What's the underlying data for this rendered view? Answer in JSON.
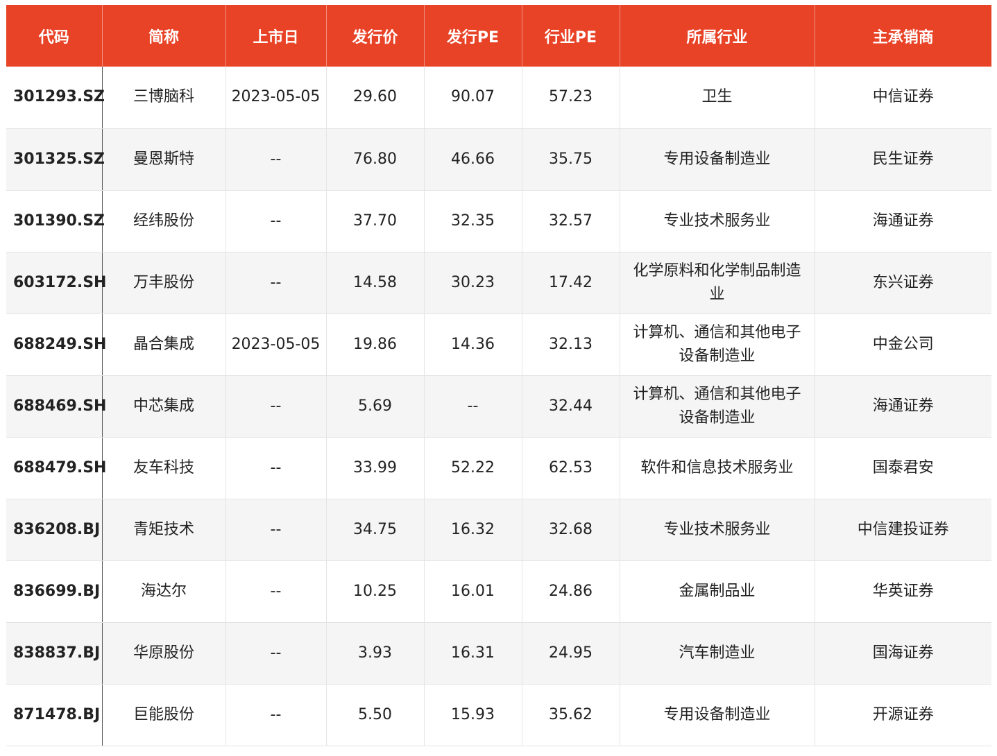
{
  "table": {
    "headers": [
      "代码",
      "简称",
      "上市日",
      "发行价",
      "发行PE",
      "行业PE",
      "所属行业",
      "主承销商"
    ],
    "rows": [
      [
        "301293.SZ",
        "三博脑科",
        "2023-05-05",
        "29.60",
        "90.07",
        "57.23",
        "卫生",
        "中信证券"
      ],
      [
        "301325.SZ",
        "曼恩斯特",
        "--",
        "76.80",
        "46.66",
        "35.75",
        "专用设备制造业",
        "民生证券"
      ],
      [
        "301390.SZ",
        "经纬股份",
        "--",
        "37.70",
        "32.35",
        "32.57",
        "专业技术服务业",
        "海通证券"
      ],
      [
        "603172.SH",
        "万丰股份",
        "--",
        "14.58",
        "30.23",
        "17.42",
        "化学原料和化学制品制造业",
        "东兴证券"
      ],
      [
        "688249.SH",
        "晶合集成",
        "2023-05-05",
        "19.86",
        "14.36",
        "32.13",
        "计算机、通信和其他电子设备制造业",
        "中金公司"
      ],
      [
        "688469.SH",
        "中芯集成",
        "--",
        "5.69",
        "--",
        "32.44",
        "计算机、通信和其他电子设备制造业",
        "海通证券"
      ],
      [
        "688479.SH",
        "友车科技",
        "--",
        "33.99",
        "52.22",
        "62.53",
        "软件和信息技术服务业",
        "国泰君安"
      ],
      [
        "836208.BJ",
        "青矩技术",
        "--",
        "34.75",
        "16.32",
        "32.68",
        "专业技术服务业",
        "中信建投证券"
      ],
      [
        "836699.BJ",
        "海达尔",
        "--",
        "10.25",
        "16.01",
        "24.86",
        "金属制品业",
        "华英证券"
      ],
      [
        "838837.BJ",
        "华原股份",
        "--",
        "3.93",
        "16.31",
        "24.95",
        "汽车制造业",
        "国海证券"
      ],
      [
        "871478.BJ",
        "巨能股份",
        "--",
        "5.50",
        "15.93",
        "35.62",
        "专用设备制造业",
        "开源证券"
      ]
    ]
  },
  "colors": {
    "header_bg": "#e94327",
    "header_text": "#ffffff",
    "row_alt_bg": "#f5f5f5"
  }
}
